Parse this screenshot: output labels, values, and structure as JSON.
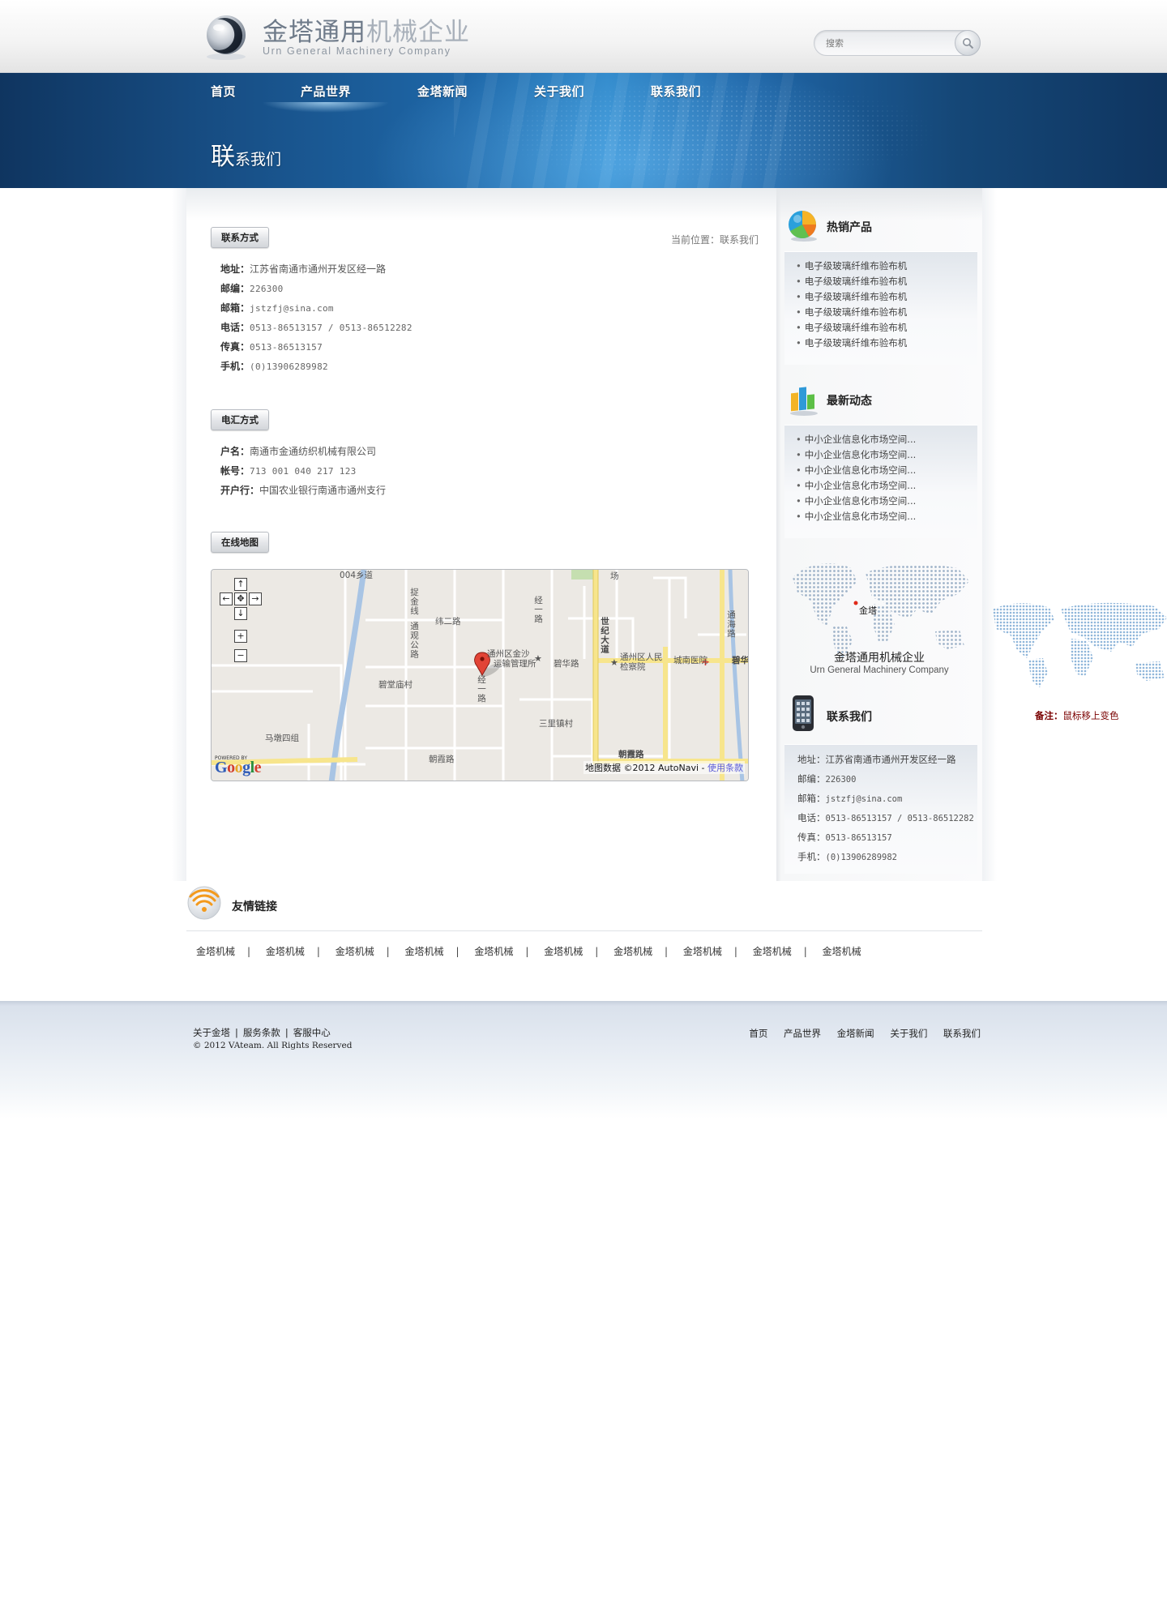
{
  "header": {
    "logo_cn_dark": "金塔通用",
    "logo_cn_light": "机械企业",
    "logo_en": "Urn General Machinery Company",
    "search_placeholder": "搜索"
  },
  "nav": {
    "items": [
      {
        "label": "首页"
      },
      {
        "label": "产品世界",
        "active": true
      },
      {
        "label": "金塔新闻"
      },
      {
        "label": "关于我们"
      },
      {
        "label": "联系我们"
      }
    ]
  },
  "banner": {
    "heading_big": "联",
    "heading_small": "系我们"
  },
  "content": {
    "breadcrumb": "当前位置：联系我们",
    "contact": {
      "button": "联系方式",
      "rows": [
        {
          "key": "地址：",
          "value": "江苏省南通市通州开发区经一路"
        },
        {
          "key": "邮编：",
          "value": "226300"
        },
        {
          "key": "邮箱：",
          "value": "jstzfj@sina.com"
        },
        {
          "key": "电话：",
          "value": "0513-86513157 / 0513-86512282"
        },
        {
          "key": "传真：",
          "value": "0513-86513157"
        },
        {
          "key": "手机：",
          "value": "(0)13906289982"
        }
      ]
    },
    "bank": {
      "button": "电汇方式",
      "rows": [
        {
          "key": "户名：",
          "value": "南通市金通纺织机械有限公司"
        },
        {
          "key": "帐号：",
          "value": "713 001 040 217 123"
        },
        {
          "key": "开户行：",
          "value": "中国农业银行南通市通州支行"
        }
      ]
    },
    "map": {
      "button": "在线地图",
      "labels": {
        "top_road": "004乡道",
        "jinxian": "捉金线",
        "tongzhen": "通观公路",
        "wei2": "纬二路",
        "jing1": "经一路",
        "jing1b": "经一路",
        "century": "世纪大道",
        "tonghai": "通海路",
        "bihua": "碧华路",
        "bitang": "碧堂庙村",
        "sanli": "三里镇村",
        "madun": "马墩四组",
        "zhaoxia": "朝霞路",
        "zhaoxia2": "朝霞路",
        "jinsha": "通州区金沙",
        "jinsha2": "运输管理所",
        "court": "通州区人民",
        "court2": "检察院",
        "hospital": "城南医院",
        "bi": "碧华",
        "chang": "场"
      },
      "controls": {
        "up": "↑",
        "down": "↓",
        "left": "←",
        "right": "→",
        "center": "✥",
        "zoom_in": "+",
        "zoom_out": "−"
      },
      "powered": "POWERED BY",
      "attribution": "地图数据 ©2012 AutoNavi - ",
      "terms": "使用条款"
    }
  },
  "sidebar": {
    "hot": {
      "title": "热销产品",
      "items": [
        "电子级玻璃纤维布验布机",
        "电子级玻璃纤维布验布机",
        "电子级玻璃纤维布验布机",
        "电子级玻璃纤维布验布机",
        "电子级玻璃纤维布验布机",
        "电子级玻璃纤维布验布机"
      ]
    },
    "news": {
      "title": "最新动态",
      "items": [
        "中小企业信息化市场空间...",
        "中小企业信息化市场空间...",
        "中小企业信息化市场空间...",
        "中小企业信息化市场空间...",
        "中小企业信息化市场空间...",
        "中小企业信息化市场空间..."
      ]
    },
    "world": {
      "marker": "金塔",
      "name_cn": "金塔通用机械企业",
      "name_en": "Urn General Machinery Company"
    },
    "contact": {
      "title": "联系我们",
      "rows": [
        {
          "key": "地址：",
          "value": "江苏省南通市通州开发区经一路"
        },
        {
          "key": "邮编：",
          "value": "226300"
        },
        {
          "key": "邮箱：",
          "value": "jstzfj@sina.com"
        },
        {
          "key": "电话：",
          "value": "0513-86513157 / 0513-86512282"
        },
        {
          "key": "传真：",
          "value": "0513-86513157"
        },
        {
          "key": "手机：",
          "value": "(0)13906289982"
        }
      ]
    }
  },
  "float_note": {
    "key": "备注：",
    "value": "鼠标移上变色"
  },
  "links": {
    "title": "友情链接",
    "items": [
      "金塔机械",
      "金塔机械",
      "金塔机械",
      "金塔机械",
      "金塔机械",
      "金塔机械",
      "金塔机械",
      "金塔机械",
      "金塔机械",
      "金塔机械"
    ],
    "separator": "|"
  },
  "footer": {
    "left_links": [
      "关于金塔",
      "服务条款",
      "客服中心"
    ],
    "separator": "|",
    "copyright": "© 2012 VAteam. All Rights Reserved",
    "nav": [
      "首页",
      "产品世界",
      "金塔新闻",
      "关于我们",
      "联系我们"
    ]
  },
  "colors": {
    "banner_dark": "#0f3560",
    "banner_light": "#2d86c8",
    "map_road_yellow": "#f7e58c",
    "map_river": "#a8c4e4",
    "note_red": "#7a0000"
  }
}
